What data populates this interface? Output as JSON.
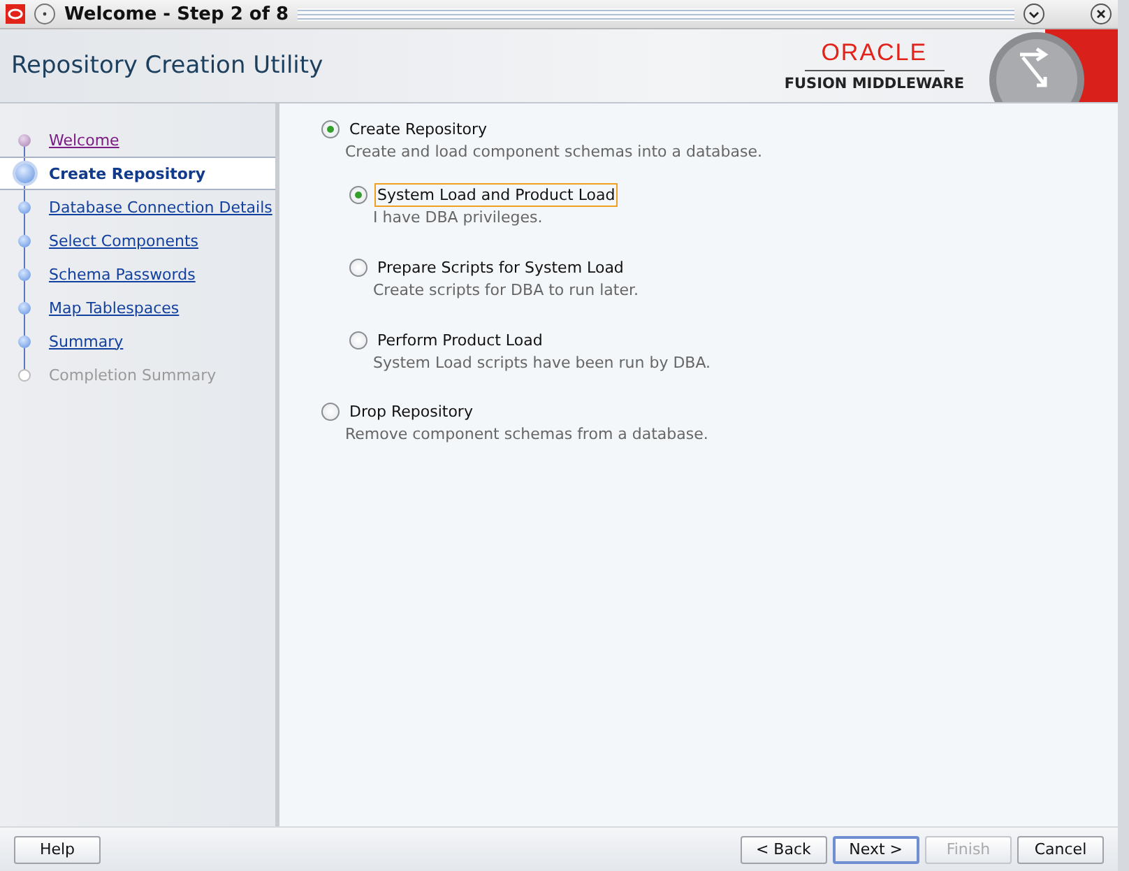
{
  "window": {
    "title": "Welcome - Step 2 of 8"
  },
  "header": {
    "title": "Repository Creation Utility",
    "brand": "ORACLE",
    "product": "FUSION MIDDLEWARE"
  },
  "steps": [
    {
      "label": "Welcome",
      "selected": false,
      "visited": true,
      "disabled": false
    },
    {
      "label": "Create Repository",
      "selected": true,
      "visited": false,
      "disabled": false
    },
    {
      "label": "Database Connection Details",
      "selected": false,
      "visited": false,
      "disabled": false
    },
    {
      "label": "Select Components",
      "selected": false,
      "visited": false,
      "disabled": false
    },
    {
      "label": "Schema Passwords",
      "selected": false,
      "visited": false,
      "disabled": false
    },
    {
      "label": "Map Tablespaces",
      "selected": false,
      "visited": false,
      "disabled": false
    },
    {
      "label": "Summary",
      "selected": false,
      "visited": false,
      "disabled": false
    },
    {
      "label": "Completion Summary",
      "selected": false,
      "visited": false,
      "disabled": true
    }
  ],
  "options": [
    {
      "label": "Create Repository",
      "description": "Create and load component schemas into a database.",
      "selected": true,
      "focused": false,
      "children": [
        {
          "label": "System Load and Product Load",
          "description": "I have DBA privileges.",
          "selected": true,
          "focused": true
        },
        {
          "label": "Prepare Scripts for System Load",
          "description": "Create scripts for DBA to run later.",
          "selected": false,
          "focused": false
        },
        {
          "label": "Perform Product Load",
          "description": "System Load scripts have been run by DBA.",
          "selected": false,
          "focused": false
        }
      ]
    },
    {
      "label": "Drop Repository",
      "description": "Remove component schemas from a database.",
      "selected": false,
      "focused": false
    }
  ],
  "buttons": {
    "left": [
      {
        "label": "Help",
        "default": false,
        "disabled": false
      }
    ],
    "right": [
      {
        "label": "< Back",
        "default": false,
        "disabled": false
      },
      {
        "label": "Next >",
        "default": true,
        "disabled": false
      },
      {
        "label": "Finish",
        "default": false,
        "disabled": true
      },
      {
        "label": "Cancel",
        "default": false,
        "disabled": false
      }
    ]
  }
}
